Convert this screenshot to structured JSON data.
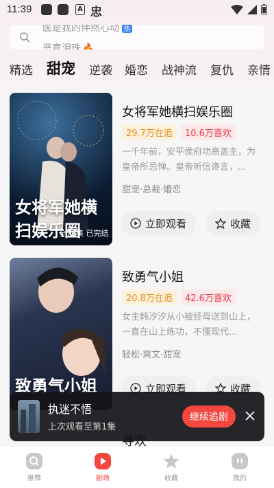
{
  "status": {
    "time": "11:39"
  },
  "search": {
    "line1": "医是我的伴然心动",
    "hot_badge": "热",
    "line2": "恶意泪珠"
  },
  "tabs": [
    "精选",
    "甜宠",
    "逆袭",
    "婚恋",
    "战神流",
    "复仇",
    "亲情"
  ],
  "active_tab": "甜宠",
  "dramas": [
    {
      "title": "女将军她横扫娱乐圈",
      "follow": "29.7万在追",
      "likes": "10.6万喜欢",
      "desc": "一千年前，安平侯府功高盖主，为皇帝所忌惮。皇帝听信谗言，...",
      "genre": "甜宠·总裁·婚恋",
      "cover_text": "女将军她横扫娱乐圈",
      "cover_sub": "全70集 已完结"
    },
    {
      "title": "致勇气小姐",
      "follow": "20.8万在追",
      "likes": "42.6万喜欢",
      "desc": "女主韩汐汐从小被经母送到山上，一直在山上练功，不懂现代...",
      "genre": "轻松·爽文·甜宠",
      "cover_text": "致勇气小姐"
    }
  ],
  "buttons": {
    "watch": "立即观看",
    "collect": "收藏"
  },
  "mini_player": {
    "title": "执迷不悟",
    "subtitle": "上次观看至第1集",
    "continue": "继续追剧"
  },
  "peek_title": "寻欢",
  "nav": [
    {
      "label": "推荐",
      "icon": "recommend-icon"
    },
    {
      "label": "剧场",
      "icon": "theater-icon"
    },
    {
      "label": "收藏",
      "icon": "star-icon"
    },
    {
      "label": "我的",
      "icon": "profile-icon"
    }
  ],
  "colors": {
    "accent": "#f3473f",
    "follow_tag": "#e0901f",
    "like_tag": "#e63c4f"
  }
}
